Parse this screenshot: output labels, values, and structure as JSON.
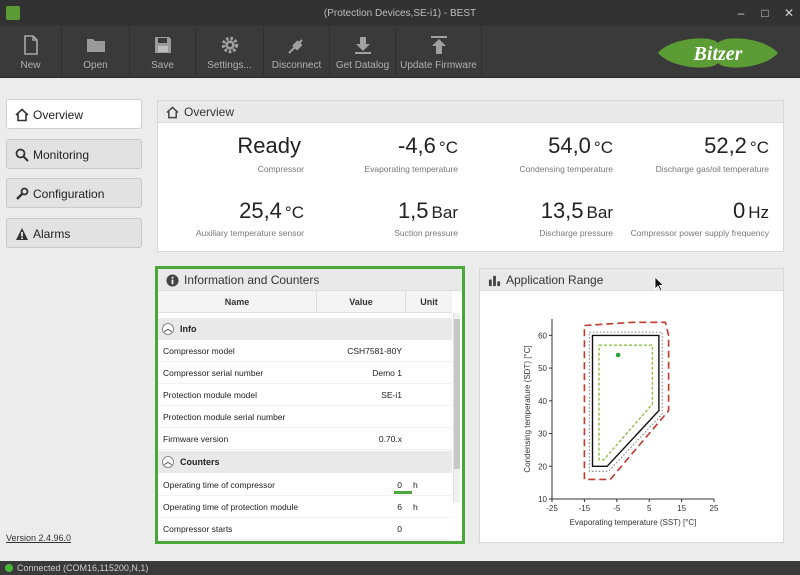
{
  "window": {
    "title": "(Protection Devices,SE-i1) - BEST"
  },
  "toolbar": {
    "new": "New",
    "open": "Open",
    "save": "Save",
    "settings": "Settings...",
    "disconnect": "Disconnect",
    "get_datalog": "Get Datalog",
    "update_firmware": "Update Firmware"
  },
  "brand": {
    "logo_text": "Bitzer",
    "color": "#5c9c35"
  },
  "nav": {
    "overview": "Overview",
    "monitoring": "Monitoring",
    "configuration": "Configuration",
    "alarms": "Alarms"
  },
  "version": "Version 2.4.96.0",
  "overview": {
    "title": "Overview",
    "items": [
      {
        "value": "Ready",
        "unit": "",
        "label": "Compressor"
      },
      {
        "value": "-4,6",
        "unit": "°C",
        "label": "Evaporating temperature"
      },
      {
        "value": "54,0",
        "unit": "°C",
        "label": "Condensing temperature"
      },
      {
        "value": "52,2",
        "unit": "°C",
        "label": "Discharge gas/oil temperature"
      },
      {
        "value": "25,4",
        "unit": "°C",
        "label": "Auxiliary temperature sensor"
      },
      {
        "value": "1,5",
        "unit": "Bar",
        "label": "Suction pressure"
      },
      {
        "value": "13,5",
        "unit": "Bar",
        "label": "Discharge pressure"
      },
      {
        "value": "0",
        "unit": "Hz",
        "label": "Compressor power supply frequency"
      }
    ]
  },
  "info": {
    "title": "Information and Counters",
    "columns": {
      "name": "Name",
      "value": "Value",
      "unit": "Unit"
    },
    "group_info": "Info",
    "group_counters": "Counters",
    "rows_info": [
      {
        "name": "Compressor model",
        "value": "CSH7581-80Y",
        "unit": ""
      },
      {
        "name": "Compressor serial number",
        "value": "Demo 1",
        "unit": ""
      },
      {
        "name": "Protection module model",
        "value": "SE-i1",
        "unit": ""
      },
      {
        "name": "Protection module serial number",
        "value": "",
        "unit": ""
      },
      {
        "name": "Firmware version",
        "value": "0.70.x",
        "unit": ""
      }
    ],
    "rows_counters": [
      {
        "name": "Operating time of compressor",
        "value": "0",
        "unit": "h"
      },
      {
        "name": "Operating time of protection module",
        "value": "6",
        "unit": "h"
      },
      {
        "name": "Compressor starts",
        "value": "0",
        "unit": ""
      }
    ],
    "highlight_color": "#4aa73a"
  },
  "application_range": {
    "title": "Application Range",
    "xlabel": "Evaporating temperature (SST) [°C]",
    "ylabel": "Condensing temperature (SDT) [°C]",
    "x_ticks": [
      "-25",
      "-15",
      "-5",
      "5",
      "15",
      "25"
    ],
    "y_ticks": [
      "10",
      "20",
      "30",
      "40",
      "50",
      "60"
    ],
    "xlim": [
      -25,
      25
    ],
    "ylim": [
      10,
      65
    ],
    "operating_point": {
      "x": -4.6,
      "y": 54.0
    },
    "envelope_solid": [
      [
        -12.5,
        60
      ],
      [
        8,
        60
      ],
      [
        8,
        37
      ],
      [
        -8,
        20
      ],
      [
        -12.5,
        20
      ]
    ],
    "envelope_red": [
      [
        -15,
        63
      ],
      [
        0,
        64
      ],
      [
        10,
        64
      ],
      [
        11,
        60
      ],
      [
        11,
        37
      ],
      [
        -7,
        16
      ],
      [
        -15,
        16
      ]
    ],
    "envelope_dotted": [
      [
        -13.5,
        61
      ],
      [
        9,
        61
      ],
      [
        9,
        36
      ],
      [
        -7.5,
        18.5
      ],
      [
        -13.5,
        18.5
      ]
    ],
    "envelope_green": [
      [
        -10.5,
        57
      ],
      [
        6,
        57
      ],
      [
        6,
        39
      ],
      [
        -9,
        22
      ],
      [
        -10.5,
        22
      ]
    ]
  },
  "status": {
    "text": "Connected (COM16,115200,N,1)"
  }
}
